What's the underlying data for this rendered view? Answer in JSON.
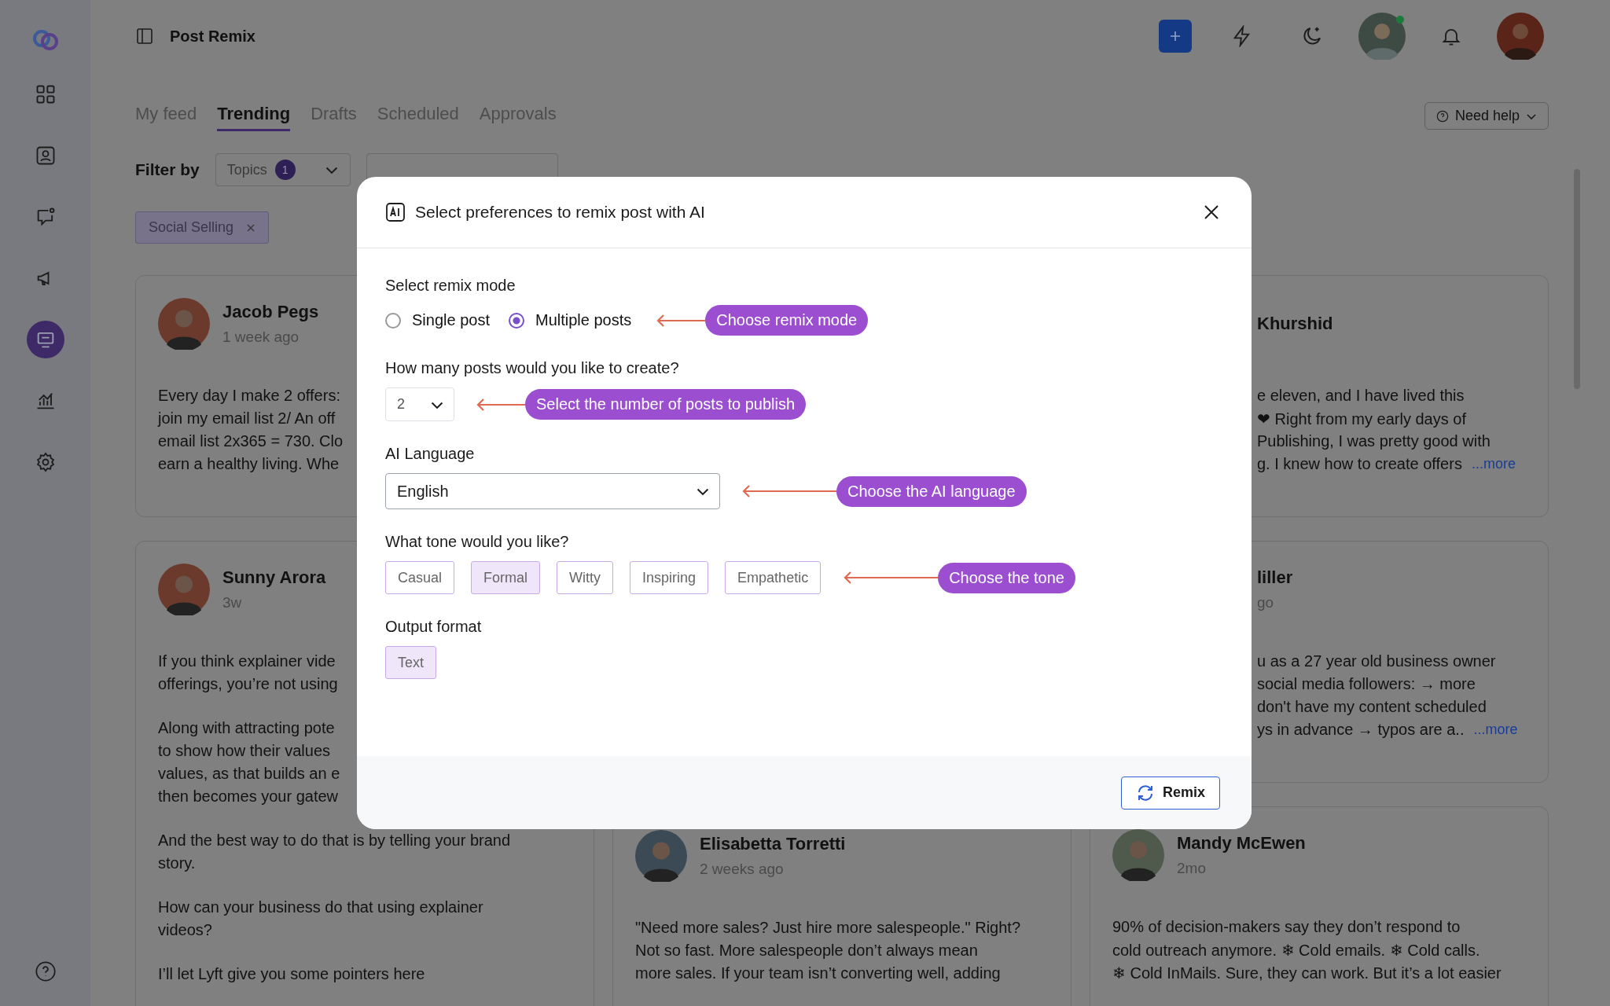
{
  "sidebar": {
    "items": [
      {
        "selected": false
      },
      {
        "selected": false
      },
      {
        "selected": false
      },
      {
        "selected": false
      },
      {
        "selected": true
      },
      {
        "selected": false
      },
      {
        "selected": false
      }
    ]
  },
  "header": {
    "title": "Post Remix",
    "avatars": [
      {
        "online": true
      },
      {
        "online": false
      }
    ]
  },
  "tabs": [
    {
      "label": "My feed",
      "selected": false
    },
    {
      "label": "Trending",
      "selected": true
    },
    {
      "label": "Drafts",
      "selected": false
    },
    {
      "label": "Scheduled",
      "selected": false
    },
    {
      "label": "Approvals",
      "selected": false
    }
  ],
  "need_help": "Need help",
  "filters": {
    "label": "Filter by",
    "topics": {
      "label": "Topics",
      "count": "1"
    },
    "active": [
      {
        "label": "Social Selling"
      }
    ]
  },
  "feed": {
    "columns": [
      [
        {
          "kind": "full",
          "author": "Jacob Pegs",
          "time": "1 week ago",
          "paragraphs": [
            [
              "Every day I make 2 offers:",
              "join my email list 2/ An off",
              "email list 2x365 = 730. Clo",
              "earn a healthy living. Whe"
            ]
          ]
        },
        {
          "kind": "full",
          "author": "Sunny Arora",
          "time": "3w",
          "paragraphs": [
            [
              "If you think explainer vide",
              "offerings, you’re not using"
            ],
            [
              "Along with attracting pote",
              "to show how their values",
              "values, as that builds an e",
              "then becomes your gatew"
            ],
            [
              "And the best way to do that is by telling your brand",
              "story."
            ],
            [
              "How can your business do that using explainer",
              "videos?"
            ],
            [
              "I’ll let Lyft give you some pointers here"
            ]
          ]
        }
      ],
      [
        {
          "kind": "full",
          "author": "Elisabetta Torretti",
          "time": "2 weeks ago",
          "paragraphs": [
            [
              "\"Need more sales? Just hire more salespeople.\" Right?",
              "Not so fast. More salespeople don’t always mean",
              "more sales. If your team isn’t converting well, adding"
            ]
          ]
        }
      ],
      [
        {
          "kind": "covered",
          "author": "Khurshid",
          "paragraphs": [
            [
              "e eleven, and I have lived this",
              "❤ Right from my early days of",
              "Publishing, I was pretty good with",
              "g. I knew how to create offers"
            ]
          ],
          "more": "...more"
        },
        {
          "kind": "covered",
          "author": "liller",
          "time": "go",
          "paragraphs": [
            [
              "u as a 27 year old business owner",
              "social media followers: → more",
              "don't have my content scheduled",
              "ys in advance → typos are a.."
            ]
          ],
          "more": "...more"
        },
        {
          "kind": "full",
          "author": "Mandy McEwen",
          "time": "2mo",
          "paragraphs": [
            [
              "90% of decision-makers say they don’t respond to",
              "cold outreach anymore. ❄ Cold emails. ❄ Cold calls.",
              "❄ Cold InMails. Sure, they can work. But it’s a lot easier"
            ]
          ]
        }
      ]
    ]
  },
  "modal": {
    "title": "Select preferences to remix post with AI",
    "sections": [
      {
        "kind": "radio",
        "label": "Select remix mode",
        "options": [
          {
            "label": "Single post",
            "selected": false
          },
          {
            "label": "Multiple posts",
            "selected": true
          }
        ],
        "annotation": "Choose remix mode"
      },
      {
        "kind": "number_select",
        "label": "How many posts would you like to create?",
        "value": "2",
        "annotation": "Select the number of posts to publish"
      },
      {
        "kind": "select",
        "label": "AI Language",
        "value": "English",
        "annotation": "Choose the AI language"
      },
      {
        "kind": "chips",
        "label": "What tone would you like?",
        "options": [
          {
            "label": "Casual",
            "selected": false
          },
          {
            "label": "Formal",
            "selected": true
          },
          {
            "label": "Witty",
            "selected": false
          },
          {
            "label": "Inspiring",
            "selected": false
          },
          {
            "label": "Empathetic",
            "selected": false
          }
        ],
        "annotation": "Choose the tone"
      },
      {
        "kind": "chips",
        "label": "Output format",
        "options": [
          {
            "label": "Text",
            "selected": true
          }
        ]
      }
    ],
    "button": "Remix"
  }
}
